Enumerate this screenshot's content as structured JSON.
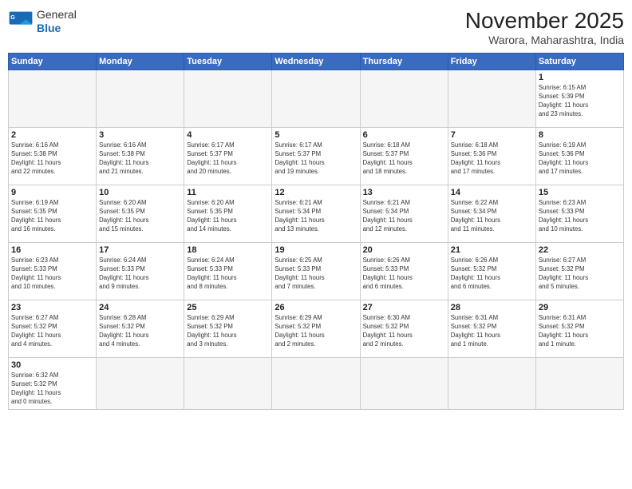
{
  "header": {
    "logo_general": "General",
    "logo_blue": "Blue",
    "month_title": "November 2025",
    "location": "Warora, Maharashtra, India"
  },
  "days_of_week": [
    "Sunday",
    "Monday",
    "Tuesday",
    "Wednesday",
    "Thursday",
    "Friday",
    "Saturday"
  ],
  "weeks": [
    [
      {
        "day": "",
        "info": ""
      },
      {
        "day": "",
        "info": ""
      },
      {
        "day": "",
        "info": ""
      },
      {
        "day": "",
        "info": ""
      },
      {
        "day": "",
        "info": ""
      },
      {
        "day": "",
        "info": ""
      },
      {
        "day": "1",
        "info": "Sunrise: 6:15 AM\nSunset: 5:39 PM\nDaylight: 11 hours\nand 23 minutes."
      }
    ],
    [
      {
        "day": "2",
        "info": "Sunrise: 6:16 AM\nSunset: 5:38 PM\nDaylight: 11 hours\nand 22 minutes."
      },
      {
        "day": "3",
        "info": "Sunrise: 6:16 AM\nSunset: 5:38 PM\nDaylight: 11 hours\nand 21 minutes."
      },
      {
        "day": "4",
        "info": "Sunrise: 6:17 AM\nSunset: 5:37 PM\nDaylight: 11 hours\nand 20 minutes."
      },
      {
        "day": "5",
        "info": "Sunrise: 6:17 AM\nSunset: 5:37 PM\nDaylight: 11 hours\nand 19 minutes."
      },
      {
        "day": "6",
        "info": "Sunrise: 6:18 AM\nSunset: 5:37 PM\nDaylight: 11 hours\nand 18 minutes."
      },
      {
        "day": "7",
        "info": "Sunrise: 6:18 AM\nSunset: 5:36 PM\nDaylight: 11 hours\nand 17 minutes."
      },
      {
        "day": "8",
        "info": "Sunrise: 6:19 AM\nSunset: 5:36 PM\nDaylight: 11 hours\nand 17 minutes."
      }
    ],
    [
      {
        "day": "9",
        "info": "Sunrise: 6:19 AM\nSunset: 5:35 PM\nDaylight: 11 hours\nand 16 minutes."
      },
      {
        "day": "10",
        "info": "Sunrise: 6:20 AM\nSunset: 5:35 PM\nDaylight: 11 hours\nand 15 minutes."
      },
      {
        "day": "11",
        "info": "Sunrise: 6:20 AM\nSunset: 5:35 PM\nDaylight: 11 hours\nand 14 minutes."
      },
      {
        "day": "12",
        "info": "Sunrise: 6:21 AM\nSunset: 5:34 PM\nDaylight: 11 hours\nand 13 minutes."
      },
      {
        "day": "13",
        "info": "Sunrise: 6:21 AM\nSunset: 5:34 PM\nDaylight: 11 hours\nand 12 minutes."
      },
      {
        "day": "14",
        "info": "Sunrise: 6:22 AM\nSunset: 5:34 PM\nDaylight: 11 hours\nand 11 minutes."
      },
      {
        "day": "15",
        "info": "Sunrise: 6:23 AM\nSunset: 5:33 PM\nDaylight: 11 hours\nand 10 minutes."
      }
    ],
    [
      {
        "day": "16",
        "info": "Sunrise: 6:23 AM\nSunset: 5:33 PM\nDaylight: 11 hours\nand 10 minutes."
      },
      {
        "day": "17",
        "info": "Sunrise: 6:24 AM\nSunset: 5:33 PM\nDaylight: 11 hours\nand 9 minutes."
      },
      {
        "day": "18",
        "info": "Sunrise: 6:24 AM\nSunset: 5:33 PM\nDaylight: 11 hours\nand 8 minutes."
      },
      {
        "day": "19",
        "info": "Sunrise: 6:25 AM\nSunset: 5:33 PM\nDaylight: 11 hours\nand 7 minutes."
      },
      {
        "day": "20",
        "info": "Sunrise: 6:26 AM\nSunset: 5:33 PM\nDaylight: 11 hours\nand 6 minutes."
      },
      {
        "day": "21",
        "info": "Sunrise: 6:26 AM\nSunset: 5:32 PM\nDaylight: 11 hours\nand 6 minutes."
      },
      {
        "day": "22",
        "info": "Sunrise: 6:27 AM\nSunset: 5:32 PM\nDaylight: 11 hours\nand 5 minutes."
      }
    ],
    [
      {
        "day": "23",
        "info": "Sunrise: 6:27 AM\nSunset: 5:32 PM\nDaylight: 11 hours\nand 4 minutes."
      },
      {
        "day": "24",
        "info": "Sunrise: 6:28 AM\nSunset: 5:32 PM\nDaylight: 11 hours\nand 4 minutes."
      },
      {
        "day": "25",
        "info": "Sunrise: 6:29 AM\nSunset: 5:32 PM\nDaylight: 11 hours\nand 3 minutes."
      },
      {
        "day": "26",
        "info": "Sunrise: 6:29 AM\nSunset: 5:32 PM\nDaylight: 11 hours\nand 2 minutes."
      },
      {
        "day": "27",
        "info": "Sunrise: 6:30 AM\nSunset: 5:32 PM\nDaylight: 11 hours\nand 2 minutes."
      },
      {
        "day": "28",
        "info": "Sunrise: 6:31 AM\nSunset: 5:32 PM\nDaylight: 11 hours\nand 1 minute."
      },
      {
        "day": "29",
        "info": "Sunrise: 6:31 AM\nSunset: 5:32 PM\nDaylight: 11 hours\nand 1 minute."
      }
    ],
    [
      {
        "day": "30",
        "info": "Sunrise: 6:32 AM\nSunset: 5:32 PM\nDaylight: 11 hours\nand 0 minutes."
      },
      {
        "day": "",
        "info": ""
      },
      {
        "day": "",
        "info": ""
      },
      {
        "day": "",
        "info": ""
      },
      {
        "day": "",
        "info": ""
      },
      {
        "day": "",
        "info": ""
      },
      {
        "day": "",
        "info": ""
      }
    ]
  ]
}
